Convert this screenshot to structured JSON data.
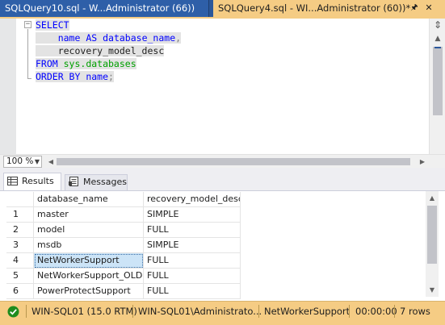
{
  "tabs": [
    {
      "label": "SQLQuery10.sql - W...Administrator (66))",
      "active": false
    },
    {
      "label": "SQLQuery4.sql - WI...Administrator (60))*",
      "active": true
    }
  ],
  "tab_controls": {
    "pin": "🖈",
    "close": "✕"
  },
  "editor": {
    "lines": [
      {
        "kw": "SELECT",
        "rest": ""
      },
      {
        "indent": "    ",
        "id": "name",
        "kw": " AS ",
        "id2": "database_name",
        "punct": ","
      },
      {
        "indent": "    ",
        "plain": "recovery_model_desc"
      },
      {
        "kw": "FROM ",
        "sys": "sys.databases"
      },
      {
        "kw": "ORDER BY ",
        "plain": "name",
        "gray": ";"
      }
    ]
  },
  "zoom": {
    "value": "100 %"
  },
  "results_tabs": {
    "results": "Results",
    "messages": "Messages"
  },
  "grid": {
    "columns": [
      "",
      "database_name",
      "recovery_model_desc"
    ],
    "rows": [
      [
        "1",
        "master",
        "SIMPLE"
      ],
      [
        "2",
        "model",
        "FULL"
      ],
      [
        "3",
        "msdb",
        "SIMPLE"
      ],
      [
        "4",
        "NetWorkerSupport",
        "FULL"
      ],
      [
        "5",
        "NetWorkerSupport_OLD",
        "FULL"
      ],
      [
        "6",
        "PowerProtectSupport",
        "FULL"
      ]
    ],
    "selected_row": 3
  },
  "status": {
    "server": "WIN-SQL01 (15.0 RTM)",
    "login": "WIN-SQL01\\Administrato...",
    "database": "NetWorkerSupport",
    "elapsed": "00:00:00",
    "rows": "7 rows"
  },
  "colors": {
    "accent": "#2b579a",
    "active_tab": "#f5cc84",
    "status_ok": "#1e8c1e"
  }
}
